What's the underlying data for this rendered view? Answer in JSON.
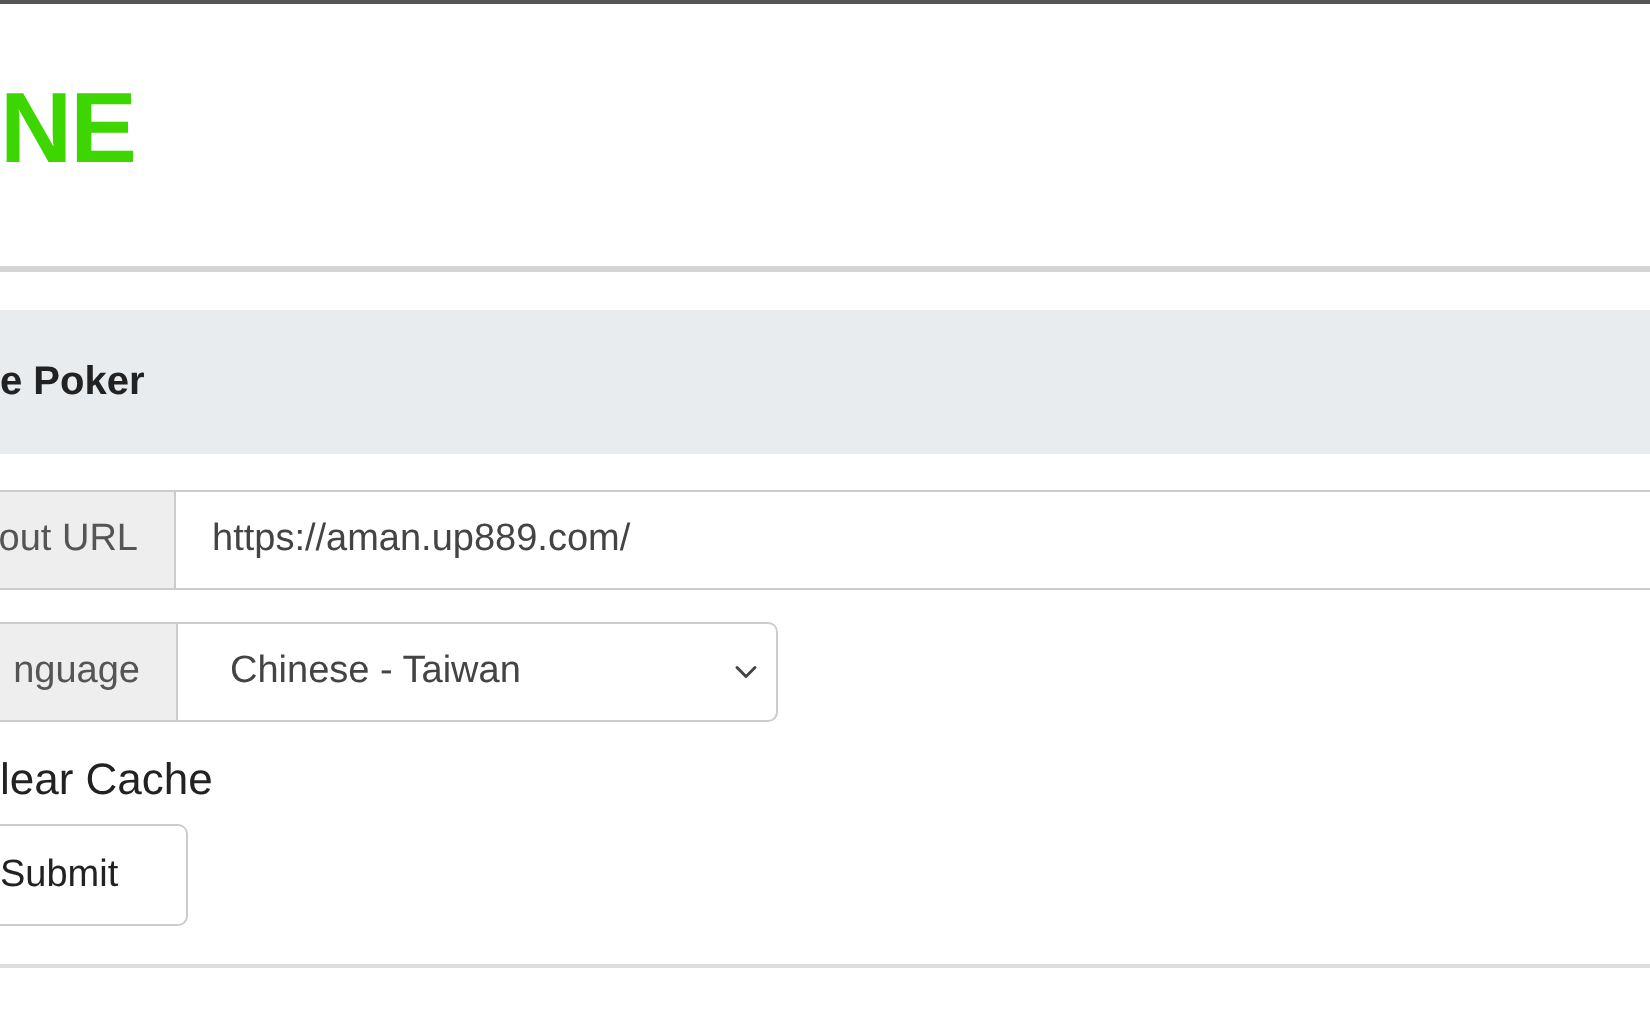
{
  "logo": {
    "text": "NE"
  },
  "panel": {
    "title": "e Poker"
  },
  "form": {
    "url_label": "out URL",
    "url_value": "https://aman.up889.com/",
    "language_label": "nguage",
    "language_value": "Chinese - Taiwan",
    "clear_cache_label": "lear Cache",
    "submit": "Submit"
  }
}
